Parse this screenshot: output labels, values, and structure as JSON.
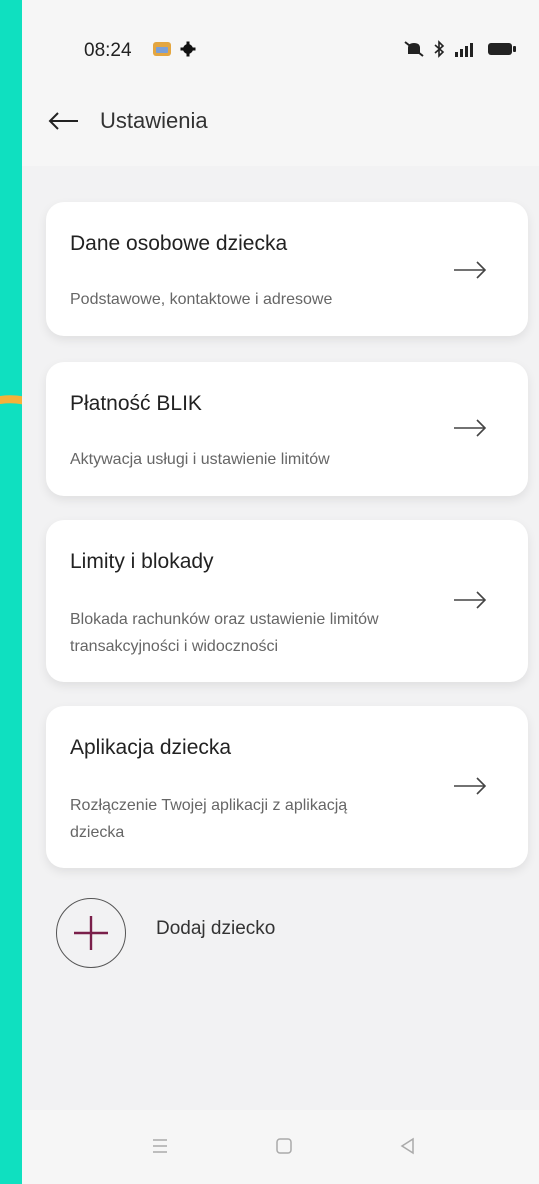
{
  "status": {
    "time": "08:24"
  },
  "header": {
    "title": "Ustawienia"
  },
  "settings": [
    {
      "title": "Dane osobowe dziecka",
      "subtitle": "Podstawowe, kontaktowe i adresowe"
    },
    {
      "title": "Płatność BLIK",
      "subtitle": "Aktywacja usługi i ustawienie limitów"
    },
    {
      "title": "Limity i blokady",
      "subtitle_line1": "Blokada rachunków oraz ustawienie limitów",
      "subtitle_line2": "transakcyjności i widoczności"
    },
    {
      "title": "Aplikacja dziecka",
      "subtitle_line1": "Rozłączenie Twojej aplikacji z aplikacją",
      "subtitle_line2": "dziecka"
    }
  ],
  "add_child": {
    "label": "Dodaj dziecko"
  },
  "colors": {
    "background": "#0fe0c0",
    "accent": "#7a1f4a",
    "pointer": "#f5b13a"
  },
  "icons": [
    "arrow-left-icon",
    "arrow-right-icon",
    "plus-icon",
    "menu-icon",
    "home-square-icon",
    "back-triangle-icon",
    "gear-icon",
    "battery-icon",
    "bluetooth-icon",
    "signal-icon",
    "mute-icon"
  ]
}
